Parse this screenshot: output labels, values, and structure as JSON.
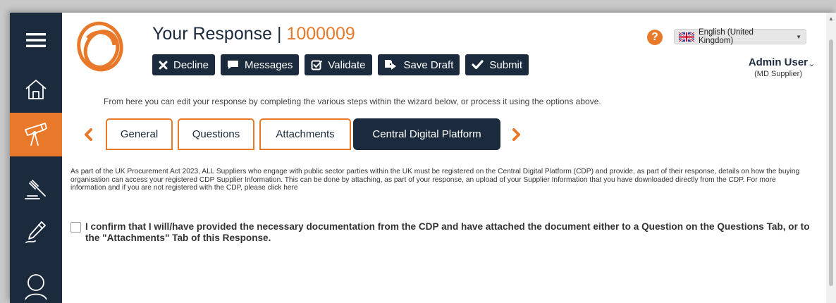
{
  "header": {
    "title": "Your Response | ",
    "reference": "1000009"
  },
  "toolbar": {
    "decline_label": "Decline",
    "messages_label": "Messages",
    "validate_label": "Validate",
    "save_draft_label": "Save Draft",
    "submit_label": "Submit"
  },
  "language": {
    "selected": "English (United Kingdom)"
  },
  "user": {
    "name": "Admin User",
    "role": "(MD Supplier)"
  },
  "info_text": "From here you can edit your response by completing the various steps within the wizard below, or process it using the options above.",
  "tabs": [
    {
      "label": "General"
    },
    {
      "label": "Questions"
    },
    {
      "label": "Attachments"
    },
    {
      "label": "Central Digital Platform"
    }
  ],
  "description": "As part of the UK Procurement Act 2023, ALL Suppliers who engage with public sector parties within the UK must be registered on the Central Digital Platform (CDP) and provide, as part of their response, details on how the buying organisation can access your registered CDP Supplier Information. This can be done by attaching, as part of your response, an upload of your Supplier Information that you have downloaded directly from the CDP. For more information and if you are not registered with the CDP, please click here",
  "confirm_text": "I confirm that I will/have provided the necessary documentation from the CDP and have attached the document either to a Question on the Questions Tab, or to the \"Attachments\" Tab of this Response.",
  "sidebar": {
    "items": [
      {
        "icon": "menu-icon"
      },
      {
        "icon": "home-icon"
      },
      {
        "icon": "telescope-icon",
        "active": true
      },
      {
        "icon": "gavel-icon"
      },
      {
        "icon": "pen-icon"
      },
      {
        "icon": "user-icon"
      }
    ]
  },
  "colors": {
    "navy": "#1b2b3d",
    "orange": "#e8792a"
  }
}
